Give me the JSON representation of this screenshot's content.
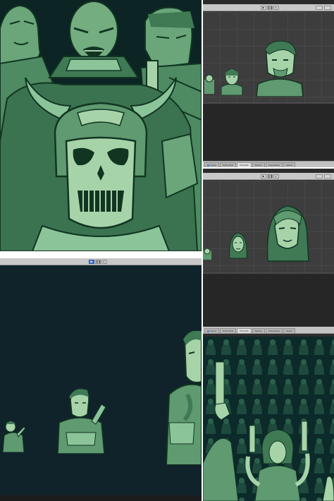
{
  "colors": {
    "art_bg": "#0d2424",
    "sprite_dark": "#2a5a3e",
    "sprite_mid": "#5f9a70",
    "sprite_light": "#a7d3a9",
    "sprite_outline": "#123522",
    "editor_dark": "#2b2b2b",
    "toolbar": "#c8c8c8",
    "play_active": "#3a72c9",
    "game_bg": "#10232a"
  },
  "toolbar": {
    "play_icon": "play-icon",
    "pause_icon": "pause-icon",
    "step_icon": "step-icon",
    "play_glyph": "▶",
    "pause_glyph": "❚❚",
    "step_glyph": "▸|"
  },
  "panel_scene1": {
    "tabs": [
      {
        "label": "Scene"
      },
      {
        "label": "Unity Hub"
      },
      {
        "label": "Portraits"
      },
      {
        "label": "Tactics"
      },
      {
        "label": "Characters"
      },
      {
        "label": "Game"
      }
    ]
  },
  "panel_scene2": {
    "tabs": [
      {
        "label": "Scene"
      },
      {
        "label": "Unity Hub"
      },
      {
        "label": "Portraits"
      },
      {
        "label": "Tactics"
      },
      {
        "label": "Characters"
      },
      {
        "label": "Game"
      }
    ]
  },
  "panel_bg": {
    "tabs": [
      {
        "label": "Scene"
      },
      {
        "label": "Unity Hub"
      },
      {
        "label": "Portraits"
      },
      {
        "label": "Tactics"
      },
      {
        "label": "Characters"
      },
      {
        "label": "Game"
      }
    ]
  }
}
